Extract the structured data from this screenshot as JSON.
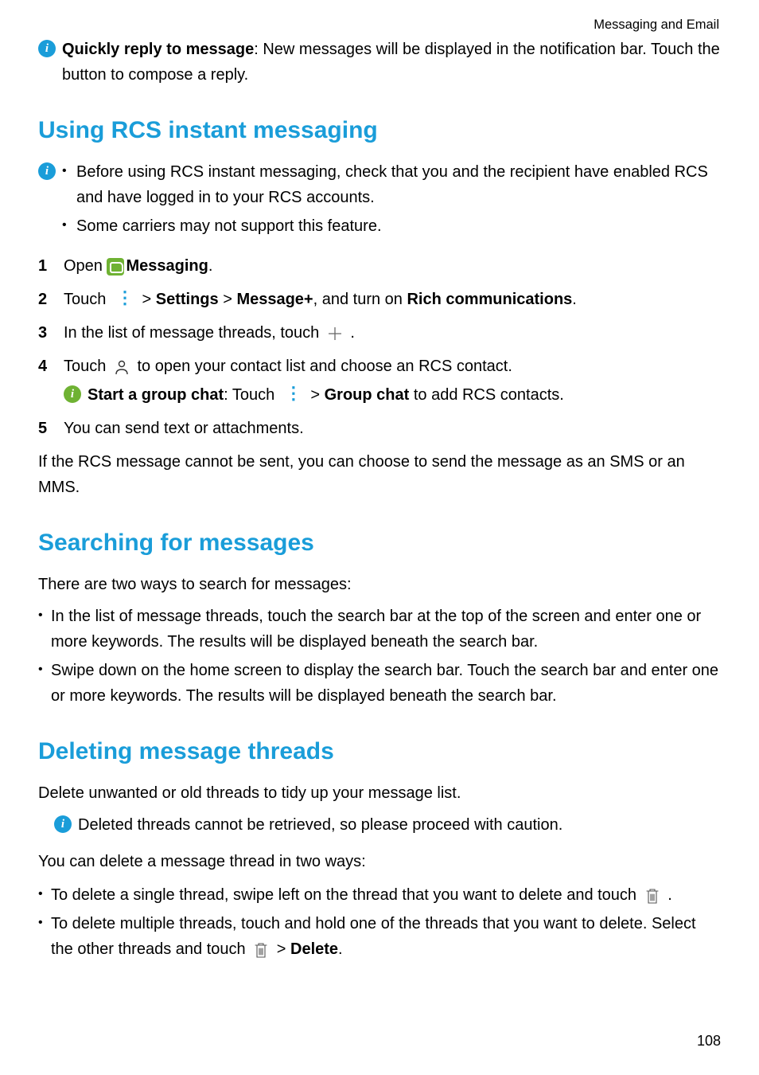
{
  "header": {
    "section": "Messaging and Email"
  },
  "intro_note": {
    "label": "Quickly reply to message",
    "text": ": New messages will be displayed in the notification bar. Touch the button to compose a reply."
  },
  "section1": {
    "heading": "Using RCS instant messaging",
    "notes": {
      "item1": "Before using RCS instant messaging, check that you and the recipient have enabled RCS and have logged in to your RCS accounts.",
      "item2": "Some carriers may not support this feature."
    },
    "steps": {
      "s1_a": "Open ",
      "s1_b": "Messaging",
      "s1_c": ".",
      "s2_a": "Touch ",
      "s2_b": " > ",
      "s2_c": "Settings",
      "s2_d": " > ",
      "s2_e": "Message+",
      "s2_f": ", and turn on ",
      "s2_g": "Rich communications",
      "s2_h": ".",
      "s3_a": "In the list of message threads, touch ",
      "s3_b": " .",
      "s4_a": "Touch ",
      "s4_b": " to open your contact list and choose an RCS contact.",
      "s4_note_a": "Start a group chat",
      "s4_note_b": ": Touch ",
      "s4_note_c": " > ",
      "s4_note_d": "Group chat",
      "s4_note_e": " to add RCS contacts.",
      "s5": "You can send text or attachments."
    },
    "after": "If the RCS message cannot be sent, you can choose to send the message as an SMS or an MMS."
  },
  "section2": {
    "heading": "Searching for messages",
    "intro": "There are two ways to search for messages:",
    "bullets": {
      "b1": "In the list of message threads, touch the search bar at the top of the screen and enter one or more keywords. The results will be displayed beneath the search bar.",
      "b2": "Swipe down on the home screen to display the search bar. Touch the search bar and enter one or more keywords. The results will be displayed beneath the search bar."
    }
  },
  "section3": {
    "heading": "Deleting message threads",
    "intro": "Delete unwanted or old threads to tidy up your message list.",
    "note": "Deleted threads cannot be retrieved, so please proceed with caution.",
    "intro2": "You can delete a message thread in two ways:",
    "bullets": {
      "b1_a": "To delete a single thread, swipe left on the thread that you want to delete and touch ",
      "b1_b": " .",
      "b2_a": "To delete multiple threads, touch and hold one of the threads that you want to delete. Select the other threads and touch ",
      "b2_b": " > ",
      "b2_c": "Delete",
      "b2_d": "."
    }
  },
  "page": "108"
}
